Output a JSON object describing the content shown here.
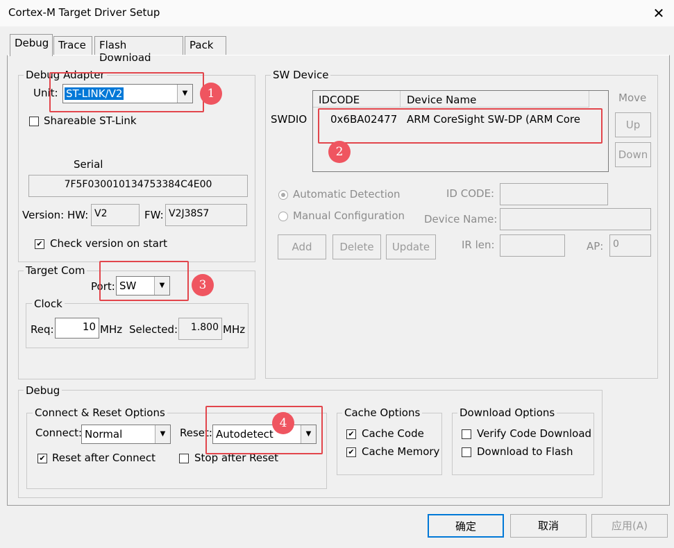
{
  "window": {
    "title": "Cortex-M Target Driver Setup",
    "close_glyph": "✕"
  },
  "tabs": [
    {
      "label": "Debug",
      "active": true
    },
    {
      "label": "Trace"
    },
    {
      "label": "Flash Download"
    },
    {
      "label": "Pack"
    }
  ],
  "debug_adapter": {
    "group_label": "Debug Adapter",
    "unit_label": "Unit:",
    "unit_value": "ST-LINK/V2",
    "shareable_label": "Shareable ST-Link",
    "serial_label": "Serial",
    "serial_value": "7F5F030010134753384C4E00",
    "version_label": "Version: HW:",
    "hw_value": "V2",
    "fw_label": "FW:",
    "fw_value": "V2J38S7",
    "check_version_label": "Check version on start"
  },
  "target_com": {
    "group_label": "Target Com",
    "port_label": "Port:",
    "port_value": "SW",
    "clock_label": "Clock",
    "req_label": "Req:",
    "req_value": "10",
    "mhz1": "MHz",
    "selected_label": "Selected:",
    "selected_value": "1.800",
    "mhz2": "MHz"
  },
  "sw_device": {
    "group_label": "SW Device",
    "swdio_label": "SWDIO",
    "col_idcode": "IDCODE",
    "col_device_name": "Device Name",
    "row_idcode": "0x6BA02477",
    "row_device": "ARM CoreSight SW-DP (ARM Core",
    "move_label": "Move",
    "up_label": "Up",
    "down_label": "Down",
    "auto_detect_label": "Automatic Detection",
    "manual_config_label": "Manual Configuration",
    "id_code_label": "ID CODE:",
    "device_name_label": "Device Name:",
    "add_label": "Add",
    "delete_label": "Delete",
    "update_label": "Update",
    "ir_len_label": "IR len:",
    "ap_label": "AP:",
    "ap_value": "0"
  },
  "debug": {
    "group_label": "Debug",
    "connect_reset_label": "Connect & Reset Options",
    "connect_label": "Connect:",
    "connect_value": "Normal",
    "reset_label": "Reset:",
    "reset_value": "Autodetect",
    "reset_after_connect_label": "Reset after Connect",
    "stop_after_reset_label": "Stop after Reset",
    "cache_options_label": "Cache Options",
    "cache_code_label": "Cache Code",
    "cache_memory_label": "Cache Memory",
    "download_options_label": "Download Options",
    "verify_code_label": "Verify Code Download",
    "download_flash_label": "Download to Flash"
  },
  "buttons": {
    "ok": "确定",
    "cancel": "取消",
    "apply": "应用(A)"
  },
  "annotations": {
    "b1": "1",
    "b2": "2",
    "b3": "3",
    "b4": "4"
  },
  "colors": {
    "annotation_red": "#e2454b",
    "selection_blue": "#0078d7"
  },
  "checks": {
    "shareable": false,
    "check_version": true,
    "reset_after_connect": true,
    "stop_after_reset": false,
    "cache_code": true,
    "cache_memory": true,
    "verify_code": false,
    "download_flash": false
  }
}
